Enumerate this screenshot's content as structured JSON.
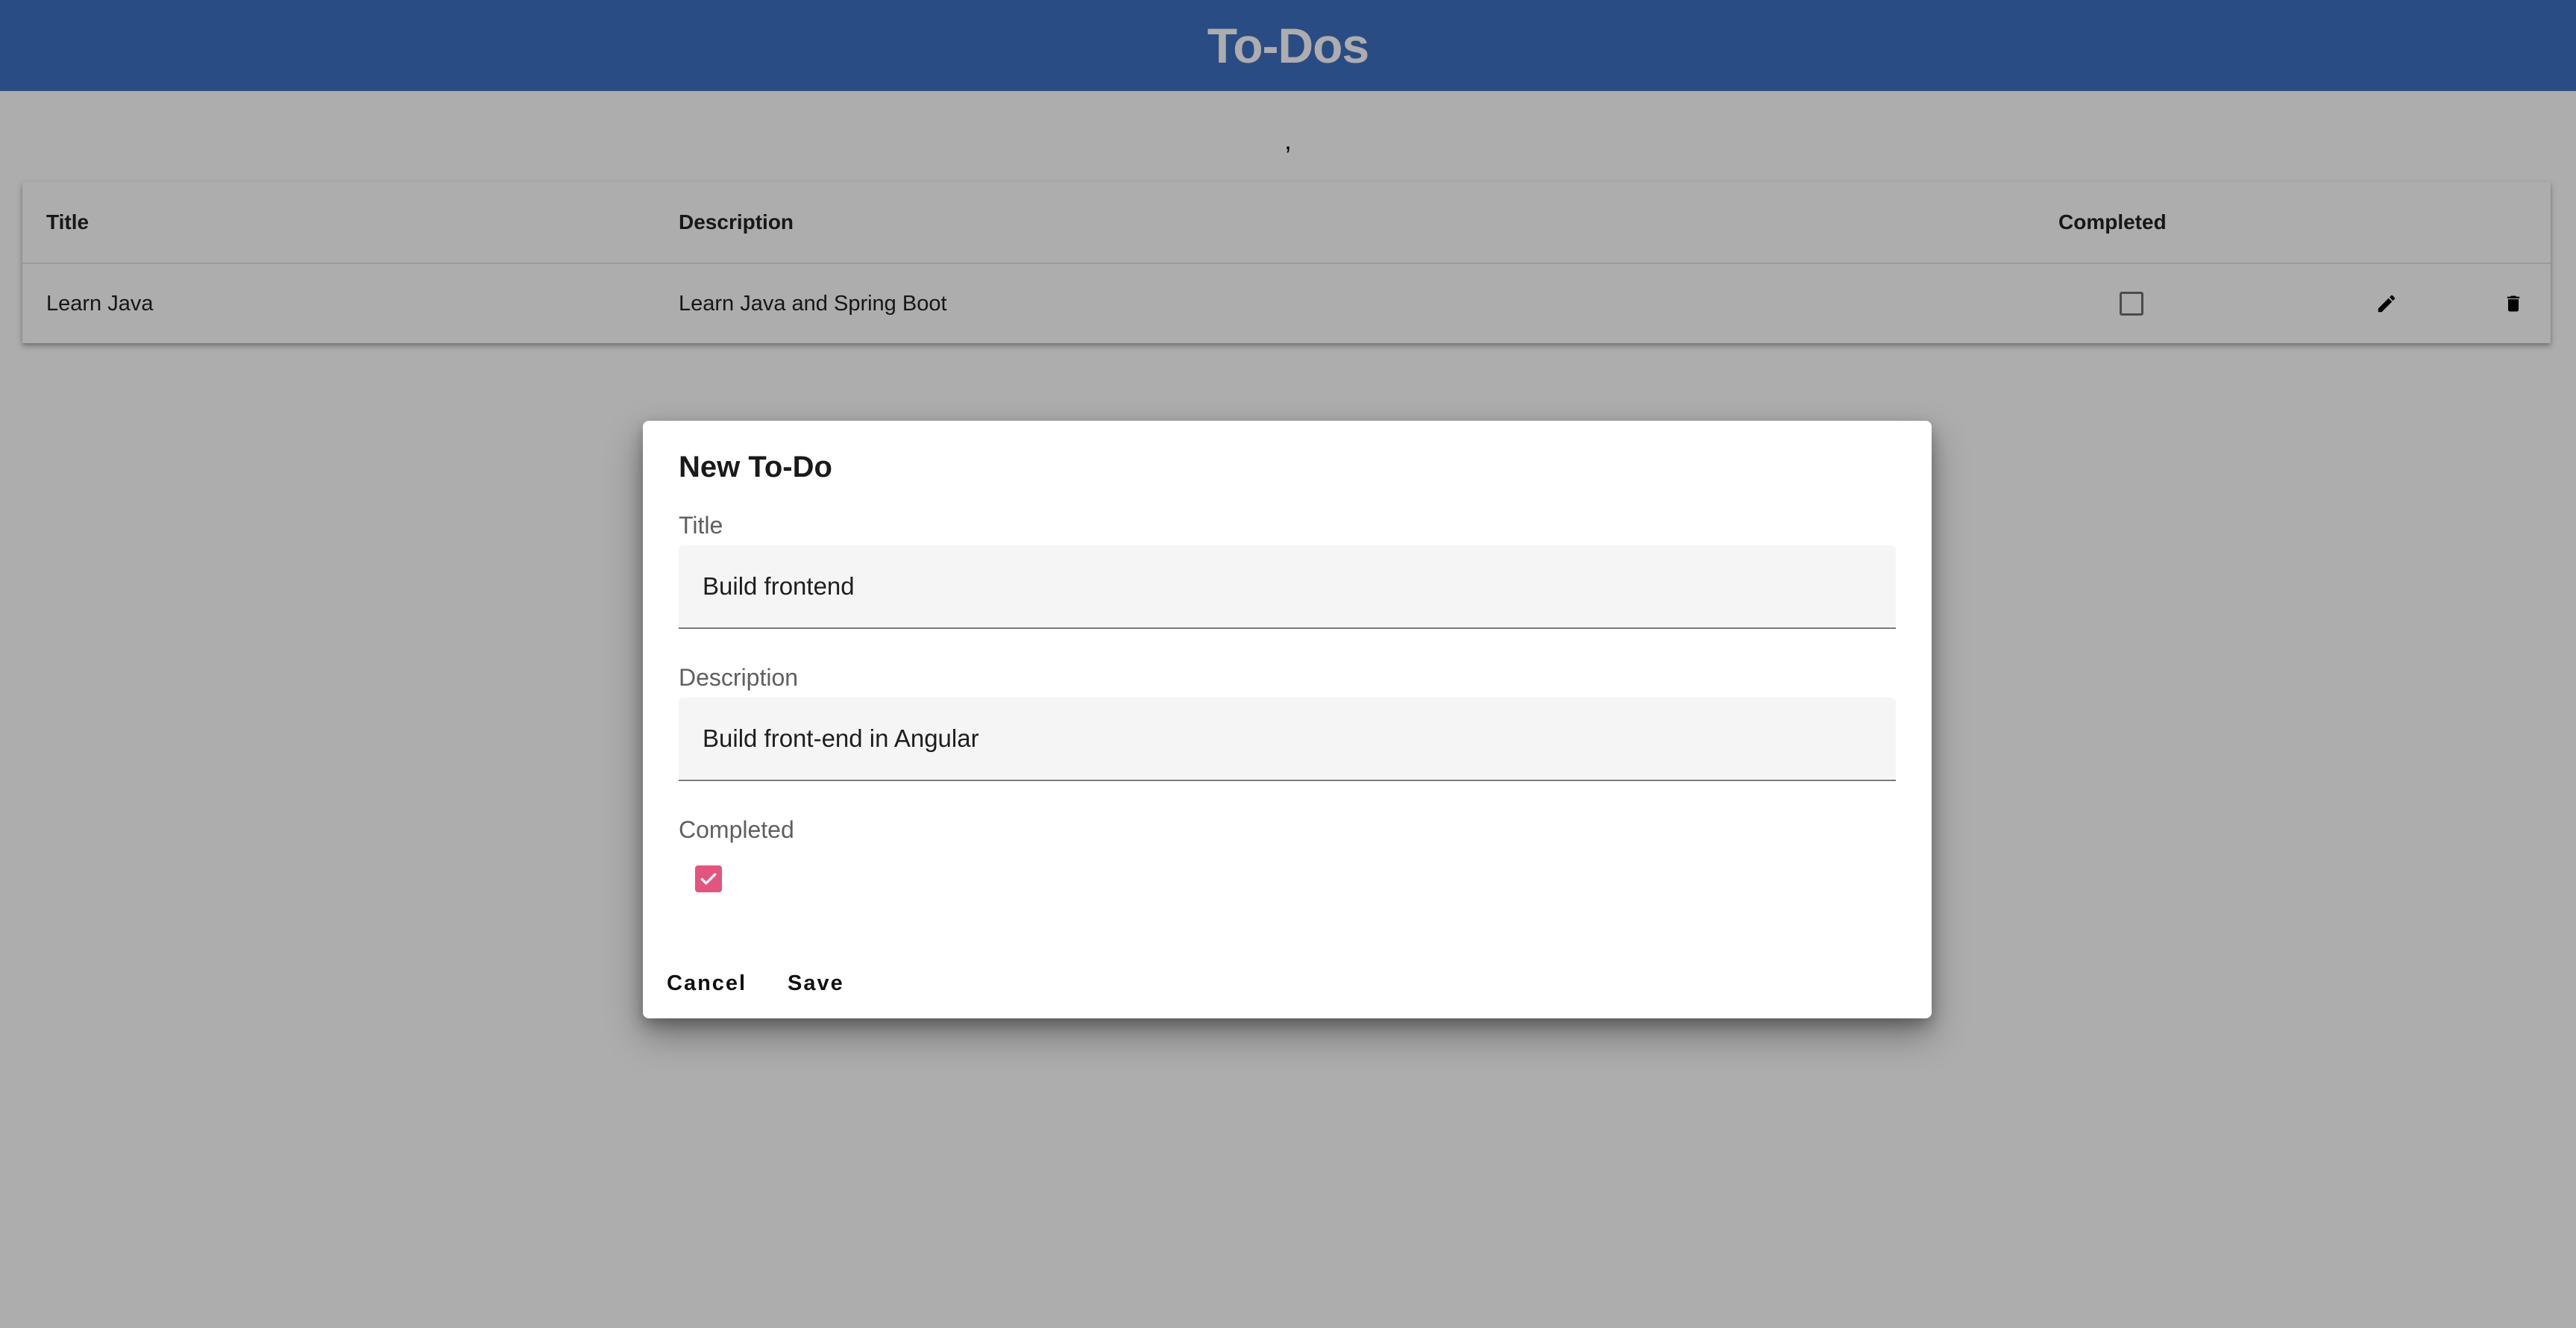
{
  "header": {
    "title": "To-Dos",
    "background_color": "#3f71c4"
  },
  "stray_text": ",",
  "table": {
    "columns": [
      "Title",
      "Description",
      "Completed"
    ],
    "rows": [
      {
        "title": "Learn Java",
        "description": "Learn Java and Spring Boot",
        "completed": false,
        "actions": [
          "edit-icon",
          "delete-icon"
        ]
      }
    ]
  },
  "dialog": {
    "title": "New To-Do",
    "fields": {
      "title_label": "Title",
      "title_value": "Build frontend",
      "description_label": "Description",
      "description_value": "Build front-end in Angular",
      "completed_label": "Completed",
      "completed_checked": true
    },
    "buttons": {
      "cancel": "Cancel",
      "save": "Save"
    },
    "checkbox_color": "#e3557e"
  }
}
